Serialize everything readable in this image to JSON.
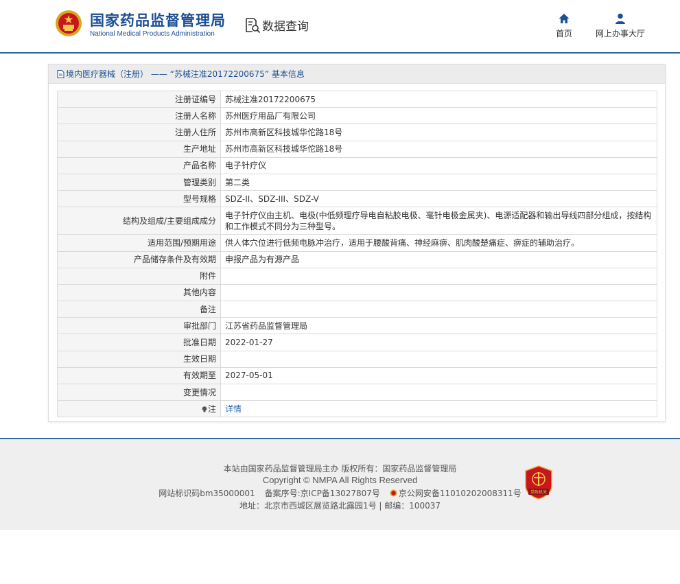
{
  "header": {
    "org_name_cn": "国家药品监督管理局",
    "org_name_en": "National Medical Products Administration",
    "query_label": "数据查询",
    "nav": [
      {
        "label": "首页",
        "icon": "home-icon"
      },
      {
        "label": "网上办事大厅",
        "icon": "user-icon"
      }
    ]
  },
  "panel": {
    "breadcrumb": "境内医疗器械（注册） —— “苏械注准20172200675” 基本信息"
  },
  "fields": [
    {
      "key": "注册证编号",
      "value": "苏械注准20172200675"
    },
    {
      "key": "注册人名称",
      "value": "苏州医疗用品厂有限公司"
    },
    {
      "key": "注册人住所",
      "value": "苏州市高新区科技城华佗路18号"
    },
    {
      "key": "生产地址",
      "value": "苏州市高新区科技城华佗路18号"
    },
    {
      "key": "产品名称",
      "value": "电子针疗仪"
    },
    {
      "key": "管理类别",
      "value": "第二类"
    },
    {
      "key": "型号规格",
      "value": "SDZ-II、SDZ-III、SDZ-V"
    },
    {
      "key": "结构及组成/主要组成成分",
      "value": "电子针疗仪由主机、电极(中低频理疗导电自粘胶电极、毫针电极金属夹)、电源适配器和输出导线四部分组成，按结构和工作模式不同分为三种型号。"
    },
    {
      "key": "适用范围/预期用途",
      "value": "供人体穴位进行低频电脉冲治疗，适用于腰酸背痛、神经麻痹、肌肉酸楚痛症、痹症的辅助治疗。"
    },
    {
      "key": "产品储存条件及有效期",
      "value": "申报产品为有源产品"
    },
    {
      "key": "附件",
      "value": ""
    },
    {
      "key": "其他内容",
      "value": ""
    },
    {
      "key": "备注",
      "value": ""
    },
    {
      "key": "审批部门",
      "value": "江苏省药品监督管理局"
    },
    {
      "key": "批准日期",
      "value": "2022-01-27"
    },
    {
      "key": "生效日期",
      "value": ""
    },
    {
      "key": "有效期至",
      "value": "2027-05-01"
    },
    {
      "key": "变更情况",
      "value": ""
    }
  ],
  "note": {
    "key": "注",
    "link_label": "详情"
  },
  "footer": {
    "line1": "本站由国家药品监督管理局主办 版权所有：国家药品监督管理局",
    "line2": "Copyright © NMPA All Rights Reserved",
    "site_id": "网站标识码bm35000001",
    "icp": "备案序号:京ICP备13027807号",
    "police": "京公网安备11010202008311号",
    "address": "地址：北京市西城区展览路北露园1号 | 邮编：100037",
    "badge_text": "党政机关"
  },
  "colors": {
    "brand_blue": "#1c4f93",
    "accent_line": "#2a68a8",
    "badge_red": "#c8161d"
  }
}
